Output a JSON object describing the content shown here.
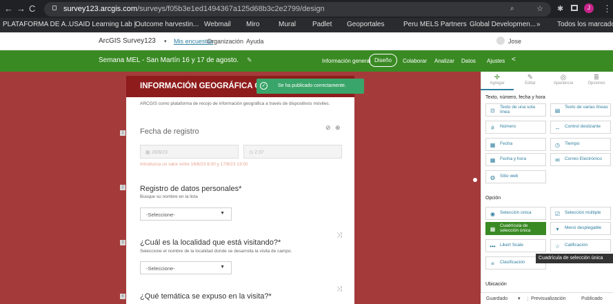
{
  "browser": {
    "url_domain": "survey123.arcgis.com",
    "url_path": "/surveys/f05b3e1ed1494367a125d68b3c2e2799/design",
    "bookmarks": [
      "PLATAFORMA DE A...",
      "USAID Learning Lab |",
      "Outcome harvestin...",
      "Webmail",
      "Miro",
      "Mural",
      "Padlet",
      "Geoportales",
      "Peru MELS Partners",
      "Global Developmen..."
    ],
    "bookmarks_more": "»",
    "all_bookmarks": "Todos los marcadores",
    "profile_initial": "J"
  },
  "app": {
    "product": "ArcGIS Survey123",
    "nav": [
      "Mis encuestas",
      "Organización",
      "Ayuda"
    ],
    "user": "Jose"
  },
  "survey_bar": {
    "title": "Semana MEL - San Martín 16 y 17 de agosto.",
    "tabs": [
      "Información general",
      "Diseño",
      "Colaborar",
      "Analizar",
      "Datos",
      "Ajustes"
    ],
    "active_tab": "Diseño"
  },
  "toast": "Se ha publicado correctamente.",
  "form": {
    "header": "INFORMACIÓN GEOGRÁFICA CON D",
    "description": "ARCGIS como plataforma de recojo de información geográfica a través de dispositivos móviles.",
    "q1": {
      "num": "1",
      "title": "Fecha de registro",
      "date": "28/8/23",
      "time": "2:37",
      "hint": "Introduzca un valor entre 16/8/23 6:00 y 17/8/23 13:00"
    },
    "q2": {
      "num": "2",
      "title": "Registro de datos personales*",
      "subtitle": "Busque su nombre en la lista",
      "select": "-Seleccione-"
    },
    "q3": {
      "num": "3",
      "title": "¿Cuál es la localidad que está visitando?*",
      "subtitle": "Seleccione el nombre de la localidad donde se desarrolla la visita de campo.",
      "select": "-Seleccione-"
    },
    "q4": {
      "num": "4",
      "title": "¿Qué temática se expuso en la visita?*"
    }
  },
  "panel": {
    "tabs": [
      "Agregar",
      "Editar",
      "Apariencia",
      "Opciones"
    ],
    "section_text": "Texto, número, fecha y hora",
    "tools_text": [
      "Texto de una sola línea",
      "Texto de varias líneas",
      "Número",
      "Control deslizante",
      "Fecha",
      "Tiempo",
      "Fecha y hora",
      "Correo Electrónico",
      "Sitio web"
    ],
    "section_option": "Opción",
    "tools_option": [
      "Selección única",
      "Selección múltiple",
      "Cuadrícula de selección única",
      "Menú desplegable",
      "Likert Scale",
      "Calificación",
      "Clasificación"
    ],
    "section_location": "Ubicación",
    "tooltip": "Cuadrícula de selección única",
    "bottom": [
      "Guardado",
      "Previsualización",
      "Publicado"
    ],
    "accent": "#2e7e9e",
    "active_tool_color": "#3a8a24"
  }
}
